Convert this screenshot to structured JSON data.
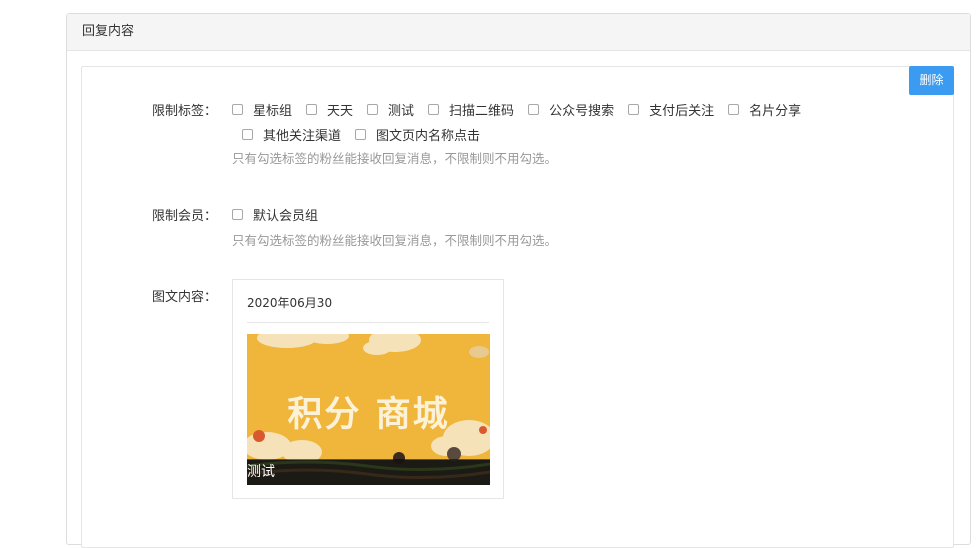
{
  "panel": {
    "title": "回复内容",
    "delete_label": "删除"
  },
  "limit_tags": {
    "label": "限制标签：",
    "options": [
      "星标组",
      "天天",
      "测试",
      "扫描二维码",
      "公众号搜索",
      "支付后关注",
      "名片分享",
      "其他关注渠道",
      "图文页内名称点击"
    ],
    "help": "只有勾选标签的粉丝能接收回复消息，不限制则不用勾选。"
  },
  "limit_members": {
    "label": "限制会员：",
    "options": [
      "默认会员组"
    ],
    "help": "只有勾选标签的粉丝能接收回复消息，不限制则不用勾选。"
  },
  "news_content": {
    "label": "图文内容：",
    "date": "2020年06月30",
    "image_text": "积分 商城",
    "caption": "测试"
  },
  "colors": {
    "primary": "#3a9bf0",
    "image_bg": "#f0b63b"
  }
}
